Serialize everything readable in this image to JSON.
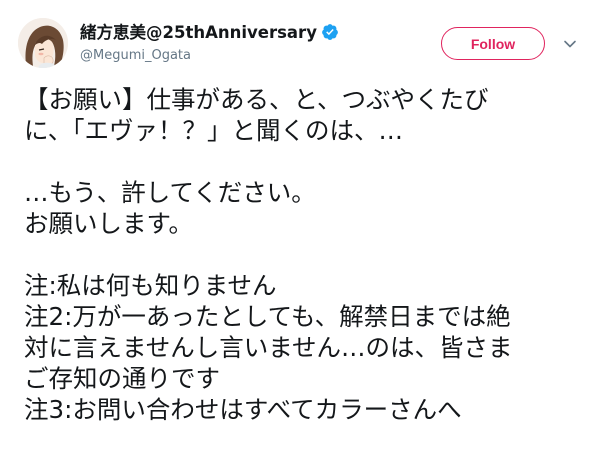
{
  "user": {
    "display_name": "緒方恵美@25thAnniversary",
    "handle": "@Megumi_Ogata",
    "verified": true
  },
  "follow_button": {
    "label": "Follow"
  },
  "icons": {
    "verified": "verified-badge-icon",
    "menu": "chevron-down-icon",
    "avatar": "avatar"
  },
  "colors": {
    "accent": "#e0245e",
    "verified": "#1da1f2",
    "handle": "#657786",
    "text": "#14171a"
  },
  "tweet": {
    "lines": [
      "【お願い】仕事がある、と、つぶやくたび",
      "に、「エヴァ！？」と聞くのは、…",
      "",
      "…もう、許してください。",
      "お願いします。",
      "",
      "注:私は何も知りません",
      "注2:万が一あったとしても、解禁日までは絶",
      "対に言えませんし言いません…のは、皆さま",
      "ご存知の通りです",
      "注3:お問い合わせはすべてカラーさんへ"
    ]
  }
}
